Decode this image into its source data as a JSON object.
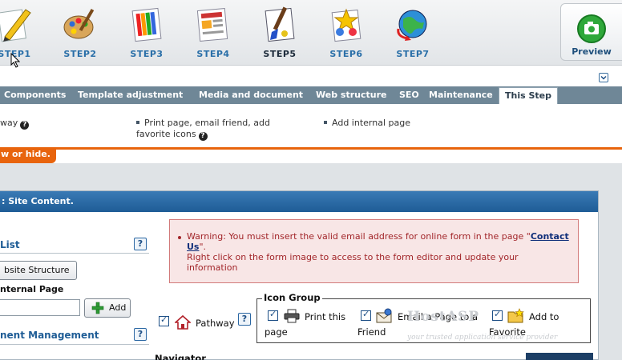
{
  "steps": [
    {
      "label": "STEP1",
      "icon": "pencil-icon"
    },
    {
      "label": "STEP2",
      "icon": "palette-icon"
    },
    {
      "label": "STEP3",
      "icon": "color-swatches-icon"
    },
    {
      "label": "STEP4",
      "icon": "document-layout-icon"
    },
    {
      "label": "STEP5",
      "icon": "paint-brush-icon"
    },
    {
      "label": "STEP6",
      "icon": "star-puzzle-icon"
    },
    {
      "label": "STEP7",
      "icon": "globe-icon"
    }
  ],
  "current_step": "STEP5",
  "preview": {
    "label": "Preview",
    "icon": "camera-icon"
  },
  "nav_tabs": [
    "Components",
    "Template adjustment",
    "Media and document",
    "Web structure",
    "SEO",
    "Maintenance",
    "This Step"
  ],
  "active_tab": "This Step",
  "help_items": {
    "item1": "way",
    "item2_line1": "Print page, email friend, add",
    "item2_line2": "favorite icons",
    "item3": "Add internal page"
  },
  "orange_tab": "w or hide.",
  "panel_title": ": Site Content.",
  "sidebar": {
    "list_title": "List",
    "website_structure_button": "bsite Structure",
    "internal_page_label": "nternal Page",
    "internal_page_value": "",
    "add_button": "Add",
    "management_title": "nent Management",
    "help": "?"
  },
  "warning": {
    "text_before": "Warning: You must insert the valid email address for online form in the page \"",
    "link": "Contact Us",
    "text_after": "\".",
    "line2": "Right click on the form image to access to the form editor and update your information"
  },
  "pathway": {
    "label": "Pathway",
    "help": "?"
  },
  "icon_group": {
    "legend": "Icon Group",
    "print": [
      "Print this",
      "page"
    ],
    "email": [
      "Email a Page to a",
      "Friend"
    ],
    "favorite": [
      "Add to",
      "Favorite"
    ]
  },
  "watermark": {
    "title": "HostASP",
    "tagline": "your trusted application service provider"
  },
  "navigator_label": "Navigator",
  "colors": {
    "accent_blue": "#1e5c96",
    "nav_gray": "#6f8797",
    "orange": "#e8640d",
    "warning_text": "#a2262a"
  }
}
